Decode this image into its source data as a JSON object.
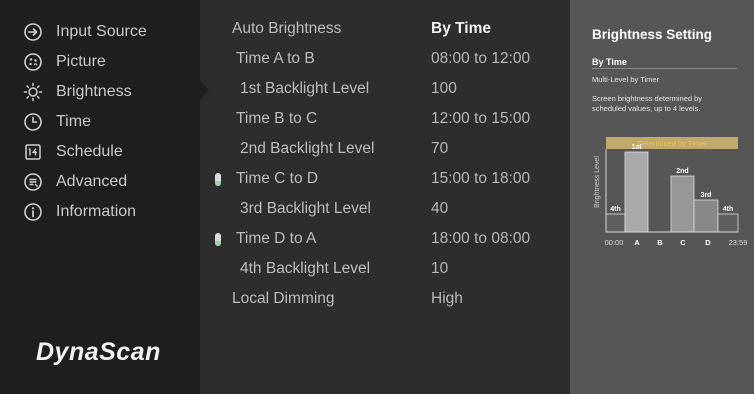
{
  "sidebar": {
    "items": [
      {
        "label": "Input Source",
        "icon": "input-source-icon"
      },
      {
        "label": "Picture",
        "icon": "picture-icon"
      },
      {
        "label": "Brightness",
        "icon": "brightness-icon"
      },
      {
        "label": "Time",
        "icon": "clock-icon"
      },
      {
        "label": "Schedule",
        "icon": "schedule-icon"
      },
      {
        "label": "Advanced",
        "icon": "advanced-icon"
      },
      {
        "label": "Information",
        "icon": "information-icon"
      }
    ],
    "selected": "Brightness",
    "brand": "DynaScan"
  },
  "settings": {
    "rows": [
      {
        "label": "Auto Brightness",
        "value": "By Time"
      },
      {
        "label": "Time A to B",
        "value": "08:00 to 12:00"
      },
      {
        "label": "1st Backlight Level",
        "value": "100"
      },
      {
        "label": "Time B to C",
        "value": "12:00 to 15:00"
      },
      {
        "label": "2nd Backlight Level",
        "value": "70"
      },
      {
        "label": "Time C to D",
        "value": "15:00 to 18:00"
      },
      {
        "label": "3rd Backlight Level",
        "value": "40"
      },
      {
        "label": "Time D to A",
        "value": "18:00 to 08:00"
      },
      {
        "label": "4th Backlight Level",
        "value": "10"
      },
      {
        "label": "Local Dimming",
        "value": "High"
      }
    ]
  },
  "info_panel": {
    "title": "Brightness Setting",
    "subtitle": "By Time",
    "desc_1": "Multi-Level by Timer",
    "desc_2": "Screen brightness determined by",
    "desc_3": "scheduled values, up to 4 levels.",
    "diagram": {
      "header": "Determined by Timer",
      "y_label": "Brightness Level",
      "level_labels": [
        "4th",
        "1st",
        "2nd",
        "3rd",
        "4th"
      ],
      "levels": [
        10,
        100,
        70,
        40,
        10
      ],
      "axis_labels": [
        "00:00",
        "A",
        "B",
        "C",
        "D",
        "23:59"
      ]
    }
  },
  "colors": {
    "sidebar_bg": "#1e1e1e",
    "main_bg": "#2d2d2d",
    "panel_bg": "#565656",
    "accent_gold": "#e8c35a",
    "indicator_green": "#9ad4b0"
  }
}
